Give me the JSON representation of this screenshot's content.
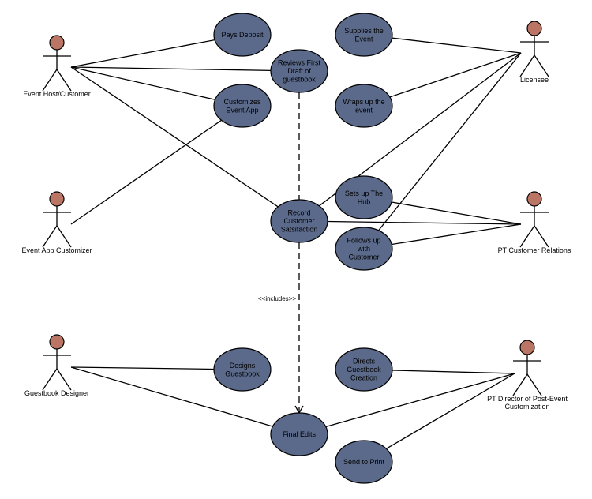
{
  "diagram": {
    "type": "use-case",
    "colors": {
      "use_case_fill": "#5b6a8a",
      "actor_head_fill": "#bb7565",
      "stroke": "#000000",
      "background": "#ffffff"
    },
    "actors": [
      {
        "id": "host",
        "label_lines": [
          "Event Host/Customer"
        ]
      },
      {
        "id": "licensee",
        "label_lines": [
          "Licensee"
        ]
      },
      {
        "id": "app_customizer",
        "label_lines": [
          "Event App Customizer"
        ]
      },
      {
        "id": "customer_relations",
        "label_lines": [
          "PT Customer Relations"
        ]
      },
      {
        "id": "guestbook_designer",
        "label_lines": [
          "Guestbook Designer"
        ]
      },
      {
        "id": "director",
        "label_lines": [
          "PT Director of Post-Event",
          "Customization"
        ]
      }
    ],
    "use_cases": [
      {
        "id": "pays_deposit",
        "label_lines": [
          "Pays Deposit"
        ]
      },
      {
        "id": "reviews_draft",
        "label_lines": [
          "Reviews First",
          "Draft of",
          "guestbook"
        ]
      },
      {
        "id": "customizes_app",
        "label_lines": [
          "Customizes",
          "Event App"
        ]
      },
      {
        "id": "supplies_event",
        "label_lines": [
          "Supplies the",
          "Event"
        ]
      },
      {
        "id": "wraps_up",
        "label_lines": [
          "Wraps up the",
          "event"
        ]
      },
      {
        "id": "sets_up_hub",
        "label_lines": [
          "Sets up The",
          "Hub"
        ]
      },
      {
        "id": "record_satisfaction",
        "label_lines": [
          "Record",
          "Customer",
          "Satsifaction"
        ]
      },
      {
        "id": "follows_up",
        "label_lines": [
          "Follows up",
          "with",
          "Customer"
        ]
      },
      {
        "id": "designs_guestbook",
        "label_lines": [
          "Designs",
          "Guestbook"
        ]
      },
      {
        "id": "directs_creation",
        "label_lines": [
          "Directs",
          "Guestbook",
          "Creation"
        ]
      },
      {
        "id": "final_edits",
        "label_lines": [
          "Final Edits"
        ]
      },
      {
        "id": "send_to_print",
        "label_lines": [
          "Send to Print"
        ]
      }
    ],
    "associations": [
      [
        "host",
        "pays_deposit"
      ],
      [
        "host",
        "reviews_draft"
      ],
      [
        "host",
        "customizes_app"
      ],
      [
        "host",
        "record_satisfaction"
      ],
      [
        "app_customizer",
        "customizes_app"
      ],
      [
        "licensee",
        "supplies_event"
      ],
      [
        "licensee",
        "wraps_up"
      ],
      [
        "licensee",
        "record_satisfaction"
      ],
      [
        "licensee",
        "follows_up"
      ],
      [
        "customer_relations",
        "sets_up_hub"
      ],
      [
        "customer_relations",
        "record_satisfaction"
      ],
      [
        "customer_relations",
        "follows_up"
      ],
      [
        "guestbook_designer",
        "designs_guestbook"
      ],
      [
        "guestbook_designer",
        "final_edits"
      ],
      [
        "director",
        "directs_creation"
      ],
      [
        "director",
        "final_edits"
      ],
      [
        "director",
        "send_to_print"
      ]
    ],
    "dependencies": [
      {
        "from": "reviews_draft",
        "to": "record_satisfaction",
        "label": "",
        "arrow": false
      },
      {
        "from": "record_satisfaction",
        "to": "final_edits",
        "label": "<<includes>>",
        "arrow": true
      }
    ]
  }
}
